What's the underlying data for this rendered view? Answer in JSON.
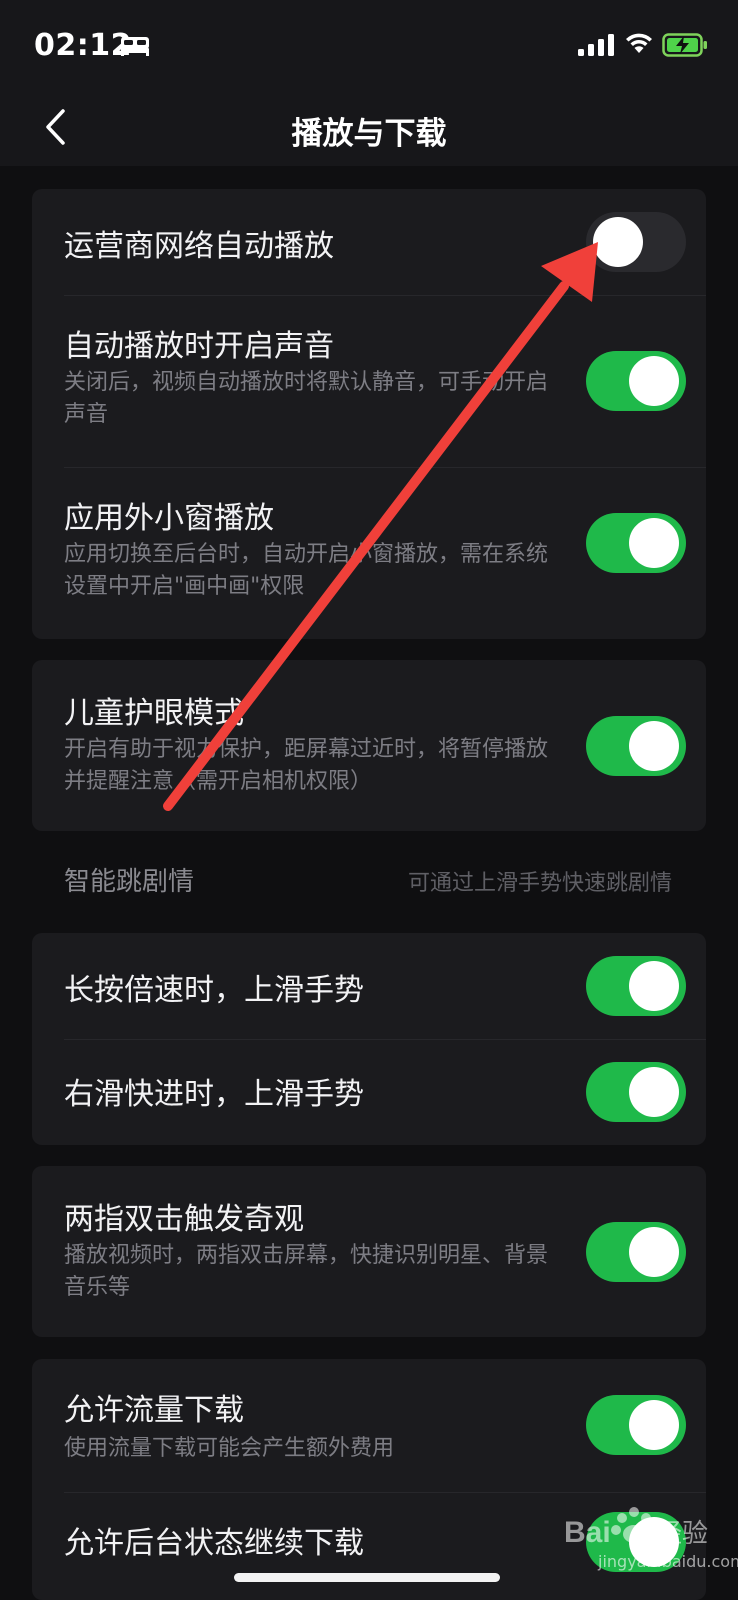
{
  "status_bar": {
    "time": "02:12",
    "icons": [
      "bed-icon",
      "signal-icon",
      "wifi-icon",
      "battery-charging-icon"
    ]
  },
  "nav": {
    "title": "播放与下载",
    "back_icon": "chevron-left-icon"
  },
  "groups": [
    {
      "rows": [
        {
          "title": "运营商网络自动播放",
          "desc": "",
          "toggle_on": false
        },
        {
          "title": "自动播放时开启声音",
          "desc": "关闭后，视频自动播放时将默认静音，可手动开启声音",
          "toggle_on": true
        },
        {
          "title": "应用外小窗播放",
          "desc": "应用切换至后台时，自动开启小窗播放，需在系统设置中开启\"画中画\"权限",
          "toggle_on": true
        }
      ]
    },
    {
      "rows": [
        {
          "title": "儿童护眼模式",
          "desc": "开启有助于视力保护，距屏幕过近时，将暂停播放并提醒注意（需开启相机权限）",
          "toggle_on": true
        }
      ]
    },
    {
      "section": {
        "title": "智能跳剧情",
        "hint": "可通过上滑手势快速跳剧情"
      },
      "rows": [
        {
          "title": "长按倍速时，上滑手势",
          "desc": "",
          "toggle_on": true
        },
        {
          "title": "右滑快进时，上滑手势",
          "desc": "",
          "toggle_on": true
        }
      ]
    },
    {
      "rows": [
        {
          "title": "两指双击触发奇观",
          "desc": "播放视频时，两指双击屏幕，快捷识别明星、背景音乐等",
          "toggle_on": true
        }
      ]
    },
    {
      "rows": [
        {
          "title": "允许流量下载",
          "desc": "使用流量下载可能会产生额外费用",
          "toggle_on": true
        },
        {
          "title": "允许后台状态继续下载",
          "desc": "",
          "toggle_on": true
        }
      ]
    }
  ],
  "annotation": {
    "arrow_color": "#f0403a"
  },
  "watermark": {
    "text": "jingyan.baidu.com"
  },
  "colors": {
    "toggle_on": "#1fb94a",
    "toggle_off": "#2a2a2e",
    "card_bg": "#1b1b1e"
  }
}
